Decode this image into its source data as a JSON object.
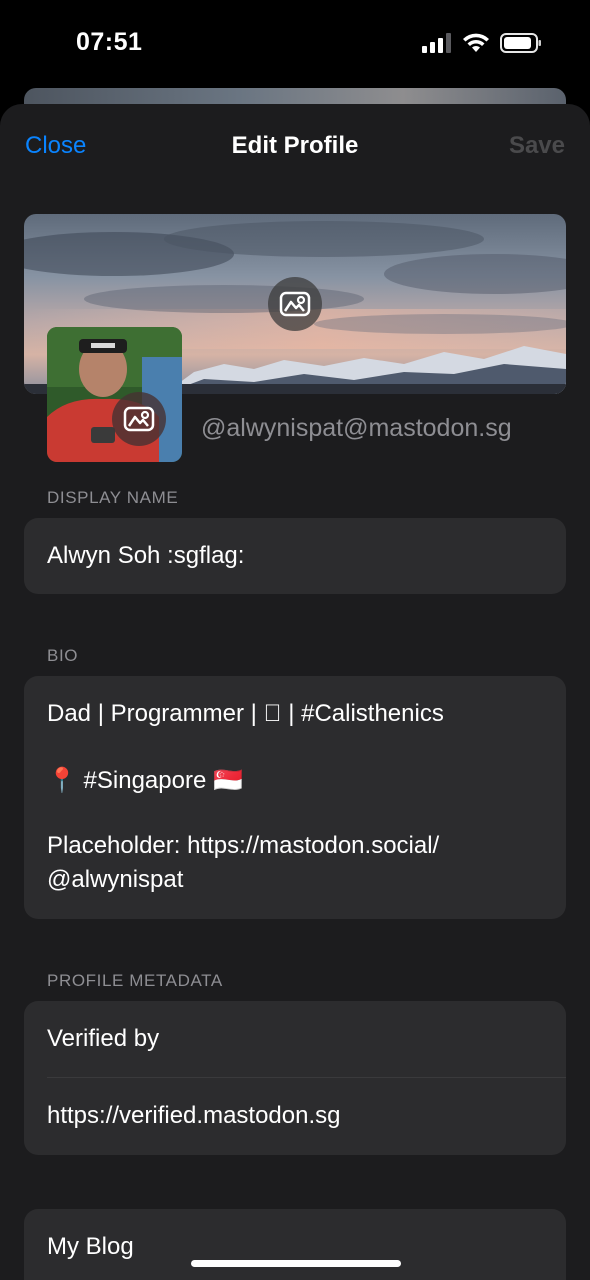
{
  "status_bar": {
    "time": "07:51"
  },
  "nav": {
    "close_label": "Close",
    "title": "Edit Profile",
    "save_label": "Save"
  },
  "profile": {
    "handle": "@alwynispat@mastodon.sg"
  },
  "display_name": {
    "section_label": "DISPLAY NAME",
    "value": "Alwyn Soh :sgflag:"
  },
  "bio": {
    "section_label": "BIO",
    "lines": [
      "Dad | Programmer |  | #Calisthenics",
      "📍 #Singapore 🇸🇬",
      "Placeholder: https://mastodon.social/",
      "@alwynispat"
    ]
  },
  "metadata": {
    "section_label": "PROFILE METADATA",
    "fields": [
      {
        "name": "Verified by",
        "value": "https://verified.mastodon.sg"
      },
      {
        "name": "My Blog"
      }
    ]
  },
  "icons": {
    "header_edit": "photo-edit-icon",
    "avatar_edit": "photo-edit-icon",
    "signal": "cellular-signal-icon",
    "wifi": "wifi-icon",
    "battery": "battery-icon"
  },
  "colors": {
    "accent": "#0a84ff",
    "sheet_bg": "#1c1c1e",
    "field_bg": "#2c2c2e",
    "secondary_text": "#8e8e93"
  }
}
